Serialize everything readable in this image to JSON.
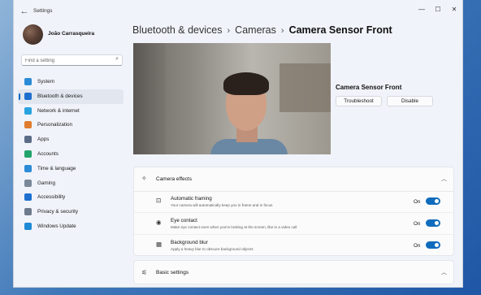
{
  "window": {
    "title": "Settings",
    "controls": {
      "minimize": "—",
      "maximize": "☐",
      "close": "✕"
    },
    "back_glyph": "←"
  },
  "user": {
    "name": "João Carrasqueira"
  },
  "search": {
    "placeholder": "Find a setting",
    "value": ""
  },
  "nav": {
    "items": [
      {
        "label": "System",
        "icon": "system-icon",
        "color": "#2b8bd6",
        "active": false
      },
      {
        "label": "Bluetooth & devices",
        "icon": "bluetooth-icon",
        "color": "#1f6fcf",
        "active": true
      },
      {
        "label": "Network & internet",
        "icon": "network-icon",
        "color": "#2aa3e0",
        "active": false
      },
      {
        "label": "Personalization",
        "icon": "brush-icon",
        "color": "#e07c2d",
        "active": false
      },
      {
        "label": "Apps",
        "icon": "apps-icon",
        "color": "#5b6c86",
        "active": false
      },
      {
        "label": "Accounts",
        "icon": "person-icon",
        "color": "#22a36b",
        "active": false
      },
      {
        "label": "Time & language",
        "icon": "globe-clock-icon",
        "color": "#2b8bd6",
        "active": false
      },
      {
        "label": "Gaming",
        "icon": "gamepad-icon",
        "color": "#7a8899",
        "active": false
      },
      {
        "label": "Accessibility",
        "icon": "accessibility-icon",
        "color": "#1f6fcf",
        "active": false
      },
      {
        "label": "Privacy & security",
        "icon": "shield-icon",
        "color": "#6d7a8c",
        "active": false
      },
      {
        "label": "Windows Update",
        "icon": "update-icon",
        "color": "#1f8ad6",
        "active": false
      }
    ]
  },
  "breadcrumb": {
    "items": [
      "Bluetooth & devices",
      "Cameras"
    ],
    "separator": "›",
    "current": "Camera Sensor Front"
  },
  "device": {
    "name": "Camera Sensor Front",
    "troubleshoot_label": "Troubleshoot",
    "disable_label": "Disable"
  },
  "camera_effects": {
    "title": "Camera effects",
    "rows": [
      {
        "title": "Automatic framing",
        "description": "Your camera will automatically keep you in frame and in focus",
        "state": "On",
        "icon": "framing-icon",
        "glyph": "⊡"
      },
      {
        "title": "Eye contact",
        "description": "Make eye contact even when you're looking at the screen, like in a video call",
        "state": "On",
        "icon": "eye-contact-icon",
        "glyph": "◉"
      },
      {
        "title": "Background blur",
        "description": "Apply a heavy blur to obscure background objects",
        "state": "On",
        "icon": "blur-icon",
        "glyph": "▦"
      }
    ]
  },
  "basic_settings": {
    "title": "Basic settings"
  },
  "colors": {
    "accent": "#0f6cbd"
  }
}
